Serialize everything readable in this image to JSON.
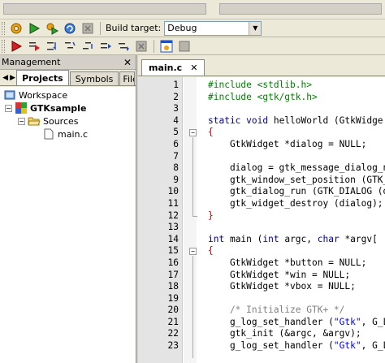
{
  "toolbar": {
    "build_target_label": "Build target:",
    "build_target_value": "Debug",
    "icons_row1": [
      "gear-icon",
      "run-icon",
      "build-run-icon",
      "rebuild-icon",
      "abort-icon"
    ],
    "icons_row2": [
      "debug-icon",
      "run-to-cursor-icon",
      "next-line-icon",
      "step-into-icon",
      "step-out-icon",
      "next-instruction-icon",
      "step-instruction-icon",
      "stop-debugger-icon",
      "debug-windows-icon",
      "various-info-icon"
    ]
  },
  "management": {
    "title": "Management",
    "tabs": [
      "Projects",
      "Symbols",
      "File"
    ],
    "tree": {
      "workspace": "Workspace",
      "project": "GTKsample",
      "folder": "Sources",
      "file": "main.c"
    }
  },
  "editor": {
    "tab_label": "main.c",
    "lines": [
      {
        "n": "1",
        "segments": [
          [
            "pp",
            "#include <stdlib.h>"
          ]
        ]
      },
      {
        "n": "2",
        "segments": [
          [
            "pp",
            "#include <gtk/gtk.h>"
          ]
        ]
      },
      {
        "n": "3",
        "segments": []
      },
      {
        "n": "4",
        "segments": [
          [
            "kw",
            "static void "
          ],
          [
            "",
            "helloWorld (GtkWidge"
          ]
        ]
      },
      {
        "n": "5",
        "segments": [
          [
            "brace",
            "{"
          ]
        ]
      },
      {
        "n": "6",
        "segments": [
          [
            "",
            "    GtkWidget *dialog = NULL;"
          ]
        ]
      },
      {
        "n": "7",
        "segments": []
      },
      {
        "n": "8",
        "segments": [
          [
            "",
            "    dialog = gtk_message_dialog_n"
          ]
        ]
      },
      {
        "n": "9",
        "segments": [
          [
            "",
            "    gtk_window_set_position (GTK_"
          ]
        ]
      },
      {
        "n": "10",
        "segments": [
          [
            "",
            "    gtk_dialog_run (GTK_DIALOG (d"
          ]
        ]
      },
      {
        "n": "11",
        "segments": [
          [
            "",
            "    gtk_widget_destroy (dialog);"
          ]
        ]
      },
      {
        "n": "12",
        "segments": [
          [
            "brace",
            "}"
          ]
        ]
      },
      {
        "n": "13",
        "segments": []
      },
      {
        "n": "14",
        "segments": [
          [
            "kw",
            "int "
          ],
          [
            "",
            "main ("
          ],
          [
            "kw",
            "int "
          ],
          [
            "",
            "argc, "
          ],
          [
            "kw",
            "char "
          ],
          [
            "",
            "*argv["
          ]
        ]
      },
      {
        "n": "15",
        "segments": [
          [
            "brace",
            "{"
          ]
        ]
      },
      {
        "n": "16",
        "segments": [
          [
            "",
            "    GtkWidget *button = NULL;"
          ]
        ]
      },
      {
        "n": "17",
        "segments": [
          [
            "",
            "    GtkWidget *win = NULL;"
          ]
        ]
      },
      {
        "n": "18",
        "segments": [
          [
            "",
            "    GtkWidget *vbox = NULL;"
          ]
        ]
      },
      {
        "n": "19",
        "segments": []
      },
      {
        "n": "20",
        "segments": [
          [
            "cm",
            "    /* Initialize GTK+ */"
          ]
        ]
      },
      {
        "n": "21",
        "segments": [
          [
            "",
            "    g_log_set_handler ("
          ],
          [
            "str",
            "\"Gtk\""
          ],
          [
            "",
            ", G_L"
          ]
        ]
      },
      {
        "n": "22",
        "segments": [
          [
            "",
            "    gtk_init (&argc, &argv);"
          ]
        ]
      },
      {
        "n": "23",
        "segments": [
          [
            "",
            "    g_log_set_handler ("
          ],
          [
            "str",
            "\"Gtk\""
          ],
          [
            "",
            ", G_L"
          ]
        ]
      }
    ]
  }
}
